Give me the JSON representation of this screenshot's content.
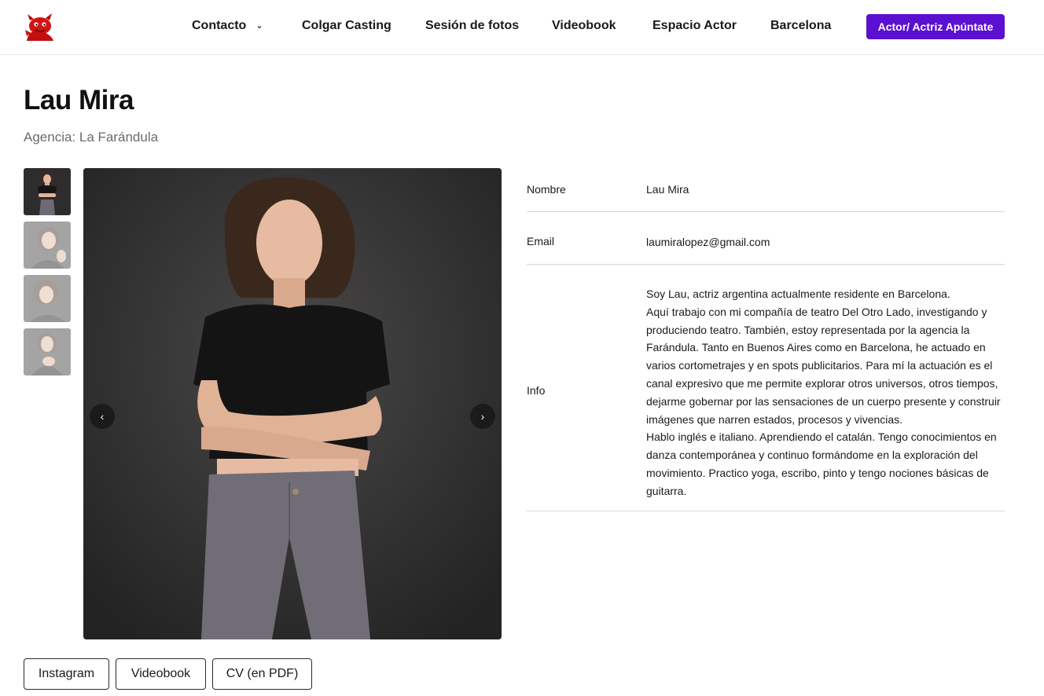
{
  "header": {
    "logo": "devil-mascot-logo",
    "nav": [
      {
        "label": "Contacto",
        "icon": "chevron-down-icon"
      },
      {
        "label": "Colgar Casting"
      },
      {
        "label": "Sesión de fotos"
      },
      {
        "label": "Videobook"
      },
      {
        "label": "Espacio Actor"
      },
      {
        "label": "Barcelona"
      }
    ],
    "cta_label": "Actor/ Actriz Apúntate"
  },
  "profile": {
    "name": "Lau Mira",
    "agency": "Agencia: La Farándula"
  },
  "gallery": {
    "thumb_count": 4,
    "active_index": 0,
    "prev_icon": "‹",
    "next_icon": "›"
  },
  "details": {
    "name_label": "Nombre",
    "name_value": "Lau Mira",
    "email_label": "Email",
    "email_value": "laumiralopez@gmail.com",
    "info_label": "Info",
    "info_paragraphs": [
      "Soy Lau, actriz argentina actualmente residente en Barcelona.",
      "Aquí trabajo con mi compañía de teatro Del Otro Lado, investigando y produciendo teatro. También, estoy representada por la agencia la Farándula. Tanto en Buenos Aires como en Barcelona, he actuado en varios cortometrajes y en spots publicitarios. Para mí la actuación es el canal expresivo que me permite explorar otros universos, otros tiempos, dejarme gobernar por las sensaciones de un cuerpo presente y construir imágenes que narren estados, procesos y vivencias.",
      "Hablo inglés e italiano. Aprendiendo el catalán.  Tengo conocimientos en danza  contemporánea y continuo formándome en la exploración del movimiento.  Practico yoga, escribo, pinto y tengo nociones básicas de guitarra."
    ]
  },
  "links": [
    {
      "label": "Instagram"
    },
    {
      "label": "Videobook"
    },
    {
      "label": "CV (en PDF)"
    }
  ],
  "colors": {
    "accent": "#5b0fd1",
    "logo_red": "#d41414",
    "muted_text": "#6b6b6b",
    "divider": "#d6d6d6"
  }
}
